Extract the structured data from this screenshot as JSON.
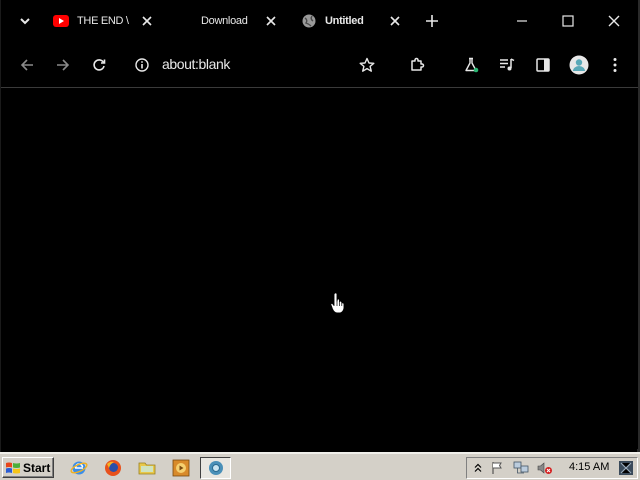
{
  "browser": {
    "tabs": [
      {
        "title": "THE END \\",
        "favicon": "youtube-icon",
        "active": false
      },
      {
        "title": "Download",
        "favicon": "none",
        "active": false
      },
      {
        "title": "Untitled",
        "favicon": "globe-icon",
        "active": true
      }
    ],
    "address_bar": {
      "url": "about:blank"
    }
  },
  "taskbar": {
    "start_label": "Start",
    "clock": "4:15 AM"
  },
  "colors": {
    "youtube_red": "#ff0000",
    "profile_accent": "#5aa9b8",
    "labs_badge": "#2bb673"
  }
}
